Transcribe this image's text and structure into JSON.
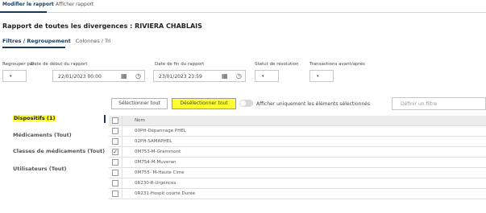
{
  "topnav": {
    "tabs": [
      "Modifier le rapport",
      "Afficher rapport"
    ]
  },
  "title": "Rapport de toutes les divergences : RIVIERA CHABLAIS",
  "subtabs": [
    "Filtres / Regroupement",
    "Colonnes / Tri"
  ],
  "filters": {
    "group_label": "Regrouper par",
    "start_label": "Date de début du rapport",
    "start_value": "22/01/2023 00:00",
    "end_label": "Date de fin du rapport",
    "end_value": "23/01/2023 23:59",
    "status_label": "Statut de résolution",
    "trans_label": "Transactions avant/après",
    "calendar_icon": "calendar-icon",
    "clock_icon": "clock-icon",
    "caret": "▾"
  },
  "sidebar": {
    "items": [
      {
        "label": "Dispositifs (1)"
      },
      {
        "label": "Médicaments (Tout)"
      },
      {
        "label": "Classes de médicaments (Tout)"
      },
      {
        "label": "Utilisateurs (Tout)"
      }
    ]
  },
  "toolbar": {
    "select_all": "Sélectionner tout",
    "deselect_all": "Désélectionner tout",
    "toggle_label": "Afficher uniquement les éléments sélectionnés",
    "filter_placeholder": "Définir un filtre"
  },
  "grid": {
    "header": "Nom",
    "check_glyph": "✓",
    "rows": [
      {
        "name": "00PH-Dépannage PHEL",
        "checked": false
      },
      {
        "name": "02PH-SAMAPHEL",
        "checked": false
      },
      {
        "name": "0M753-M-Grammont",
        "checked": true
      },
      {
        "name": "0M754-M-Muveran",
        "checked": false
      },
      {
        "name": "0M755- M-Haute Cime",
        "checked": false
      },
      {
        "name": "0R230-R-Urgences",
        "checked": false
      },
      {
        "name": "0R231-Hospit courte Durée",
        "checked": false
      }
    ]
  }
}
